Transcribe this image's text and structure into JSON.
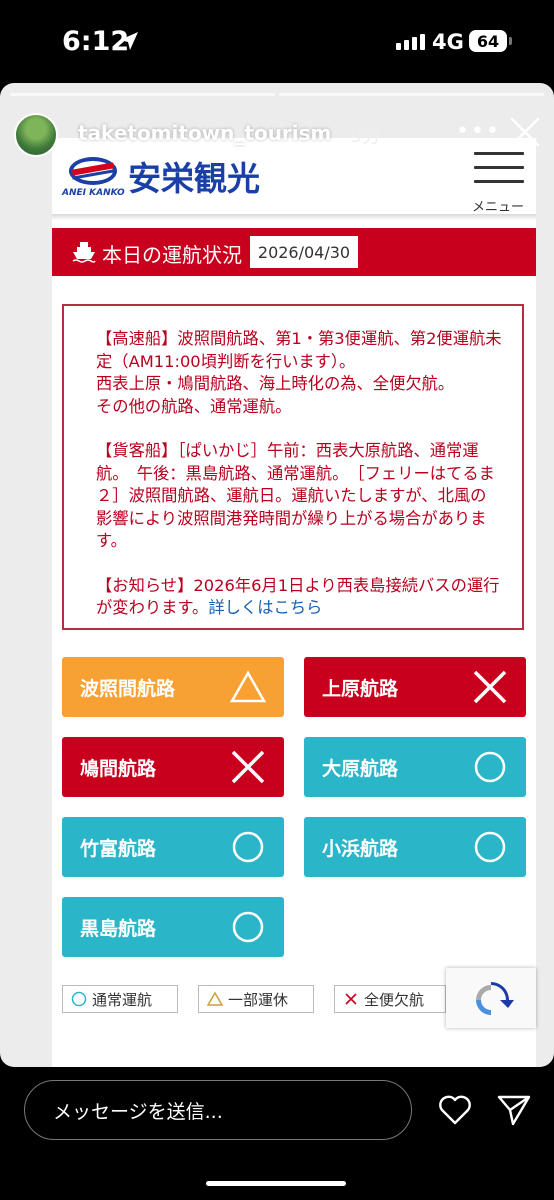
{
  "status_bar": {
    "time": "6:12",
    "network": "4G",
    "battery": "64"
  },
  "story": {
    "username": "taketomitown_tourism",
    "time_ago": "9分",
    "more_icon": "ellipsis-icon",
    "close_icon": "close-icon"
  },
  "site": {
    "logo_text": "安栄観光",
    "logo_sub": "ANEI KANKO",
    "menu_label": "メニュー",
    "operation_title": "本日の運航状況",
    "operation_date": "2026/04/30",
    "notice": {
      "paragraph1": "【高速船】波照間航路、第1・第3便運航、第2便運航未定（AM11:00頃判断を行います）。\n西表上原・鳩間航路、海上時化の為、全便欠航。\nその他の航路、通常運航。",
      "paragraph2": "【貨客船】［ぱいかじ］午前：西表大原航路、通常運航。　午後：黒島航路、通常運航。　［フェリーはてるま２］波照間航路、運航日。運航いたしますが、北風の影響により波照間港発時間が繰り上がる場合があります。",
      "paragraph3": "【お知らせ】2026年6月1日より西表島接続バスの運行が変わります。",
      "link": "詳しくはこちら"
    },
    "routes": [
      {
        "name": "波照間航路",
        "status": "△"
      },
      {
        "name": "上原航路",
        "status": "×"
      },
      {
        "name": "鳩間航路",
        "status": "×"
      },
      {
        "name": "大原航路",
        "status": "○"
      },
      {
        "name": "竹富航路",
        "status": "○"
      },
      {
        "name": "小浜航路",
        "status": "○"
      },
      {
        "name": "黒島航路",
        "status": "○"
      }
    ],
    "legend": {
      "normal": "通常運航",
      "partial": "一部運休",
      "cancelled": "全便欠航"
    },
    "colors": {
      "partial": "#f7a135",
      "cancelled": "#c8001e",
      "normal": "#2bb5c8"
    }
  },
  "bottom_bar": {
    "message_placeholder": "メッセージを送信...",
    "heart_icon": "heart-icon",
    "send_icon": "send-icon"
  }
}
